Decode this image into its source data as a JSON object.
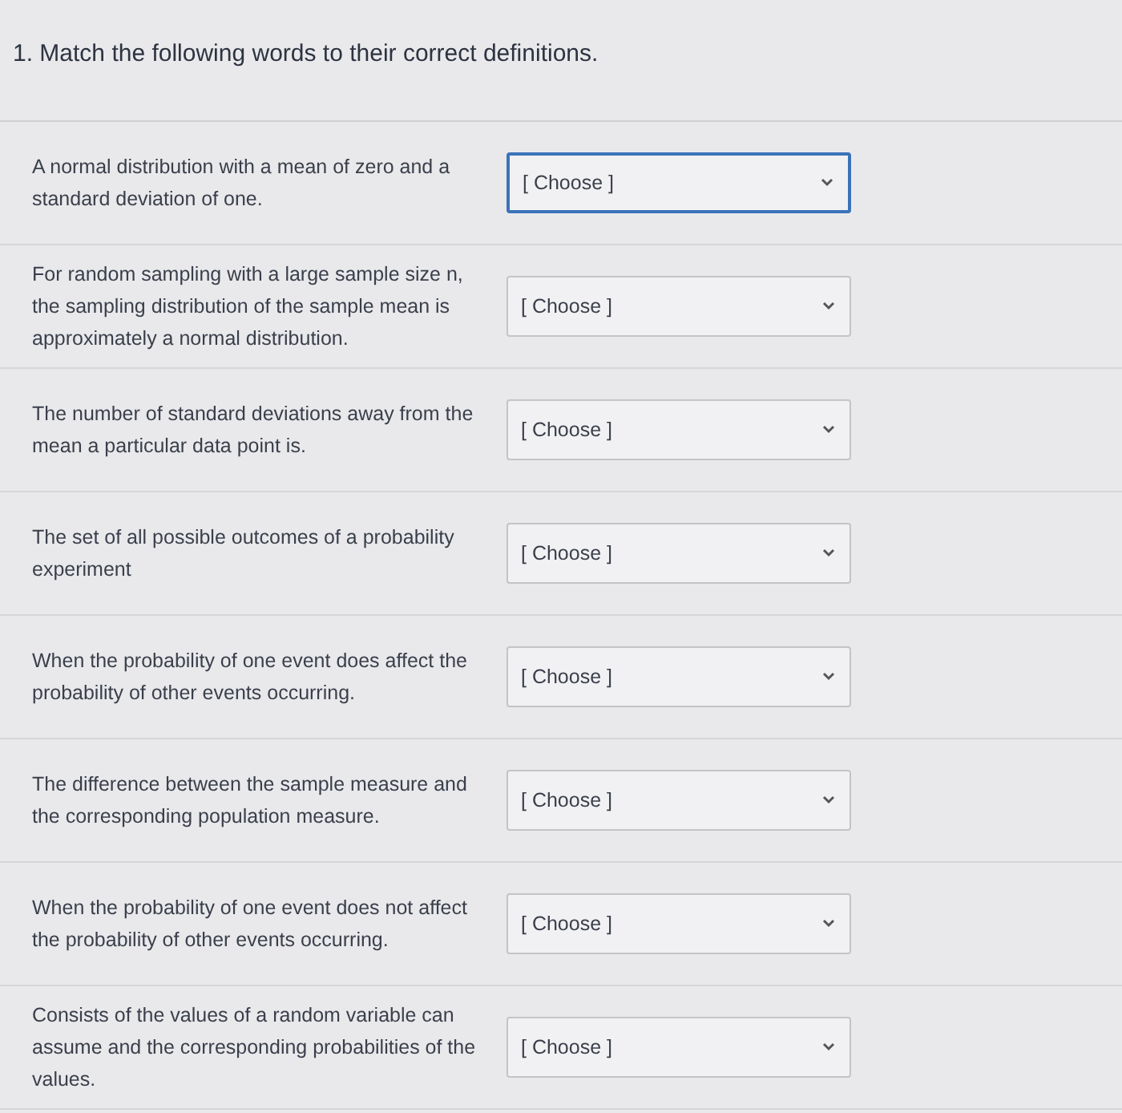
{
  "question": {
    "title": "1. Match the following words to their correct definitions."
  },
  "rows": [
    {
      "definition": "A normal distribution with a mean of zero and a standard deviation of one.",
      "select": "[ Choose ]",
      "focused": true
    },
    {
      "definition": "For random sampling with a large sample size n, the sampling distribution of the sample mean is approximately a normal distribution.",
      "select": "[ Choose ]",
      "focused": false
    },
    {
      "definition": "The number of standard deviations away from the mean a particular data point is.",
      "select": "[ Choose ]",
      "focused": false
    },
    {
      "definition": "The set of all possible outcomes of a probability experiment",
      "select": "[ Choose ]",
      "focused": false
    },
    {
      "definition": "When the probability of one event does affect the probability of other events occurring.",
      "select": "[ Choose ]",
      "focused": false
    },
    {
      "definition": "The difference between the sample measure and the corresponding population measure.",
      "select": "[ Choose ]",
      "focused": false
    },
    {
      "definition": "When the probability of one event does not affect the probability of other events occurring.",
      "select": "[ Choose ]",
      "focused": false
    },
    {
      "definition": "Consists of the values of a random variable can assume and the corresponding probabilities of the values.",
      "select": "[ Choose ]",
      "focused": false
    }
  ]
}
